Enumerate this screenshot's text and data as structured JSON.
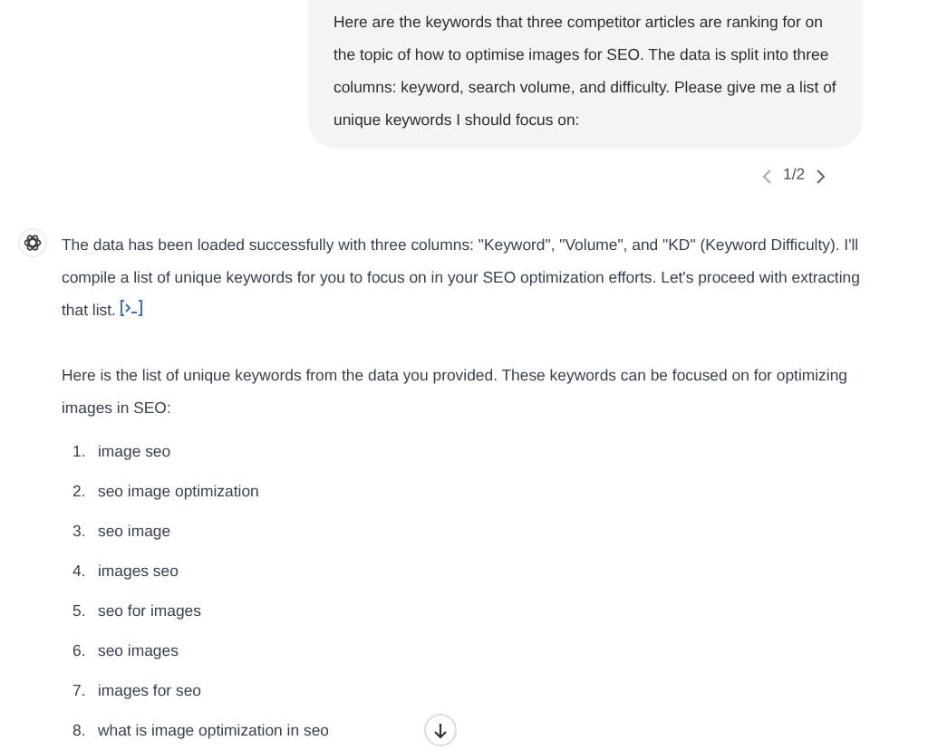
{
  "user_message": {
    "text": "Here are the keywords that three competitor articles are ranking for on the topic of how to optimise images for SEO. The data is split into three columns: keyword, search volume, and difficulty. Please give me a list of unique keywords I should focus on:"
  },
  "pagination": {
    "label": "1/2"
  },
  "assistant_message": {
    "paragraphs": [
      {
        "text": "The data has been loaded successfully with three columns: \"Keyword\", \"Volume\", and \"KD\" (Keyword Difficulty). I'll compile a list of unique keywords for you to focus on in your SEO optimization efforts. Let's proceed with extracting that list.",
        "code_link": true
      },
      {
        "text": "Here is the list of unique keywords from the data you provided. These keywords can be focused on for optimizing images in SEO:",
        "code_link": false
      }
    ],
    "keywords": [
      {
        "number": "1.",
        "text": "image seo"
      },
      {
        "number": "2.",
        "text": "seo image optimization"
      },
      {
        "number": "3.",
        "text": "seo image"
      },
      {
        "number": "4.",
        "text": "images seo"
      },
      {
        "number": "5.",
        "text": "seo for images"
      },
      {
        "number": "6.",
        "text": "seo images"
      },
      {
        "number": "7.",
        "text": "images for seo"
      },
      {
        "number": "8.",
        "text": "what is image optimization in seo"
      }
    ]
  }
}
